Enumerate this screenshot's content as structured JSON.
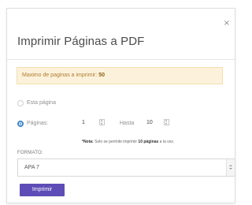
{
  "dialog": {
    "title": "Imprimir Páginas a PDF",
    "close_symbol": "×",
    "alert_prefix": "Maximo de paginas a imprimir: ",
    "alert_value": "50",
    "options": {
      "this_page_label": "Esta página",
      "pages_label": "Páginas:",
      "from_value": "1",
      "to_label": "Hasta",
      "to_value": "10",
      "selected": "pages"
    },
    "note_prefix": "*Nota:",
    "note_text_before": " Solo se permite imprimir ",
    "note_pages": "10 páginas",
    "note_text_after": " a la vez.",
    "format_label": "FORMATO:",
    "format_value": "APA 7",
    "print_button": "Imprimir"
  },
  "icons": {
    "close": "close-icon",
    "radio_unchecked": "radio-unchecked-icon",
    "radio_checked": "radio-checked-icon",
    "stepper": "spinner-arrows-icon",
    "dropdown": "select-arrows-icon"
  },
  "colors": {
    "alert_background": "#fcf2dc",
    "alert_border": "#f3dfae",
    "alert_text": "#b07c2f",
    "radio_active": "#3c86c7",
    "print_button": "#5e4db6"
  }
}
